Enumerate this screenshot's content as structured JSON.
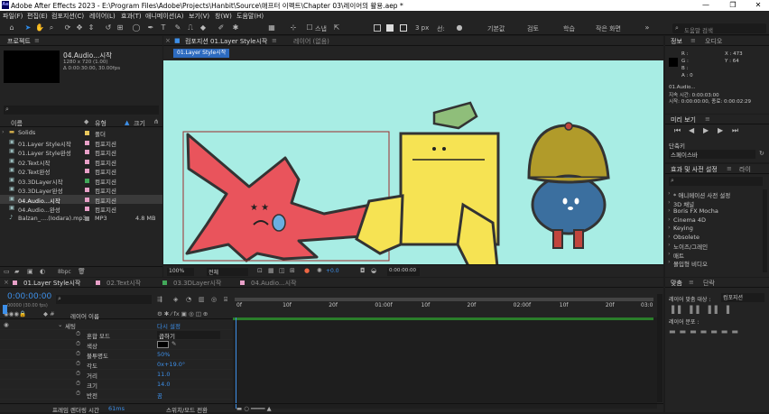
{
  "window": {
    "title": "Adobe After Effects 2023 - E:\\Program Files\\Adobe\\Projects\\Hanbit\\Source\\애프터 이펙트\\Chapter 03\\레이어의 활용.aep *",
    "minimize": "—",
    "maximize": "❐",
    "close": "✕"
  },
  "menu": [
    "파일(F)",
    "편집(E)",
    "컴포지션(C)",
    "레이어(L)",
    "효과(T)",
    "애니메이션(A)",
    "보기(V)",
    "창(W)",
    "도움말(H)"
  ],
  "toolbar": {
    "snap_label": "스냅",
    "px_value": "3 px",
    "shape_label": "칠:",
    "stroke_label": "선:",
    "workspaces": [
      "기본값",
      "검토",
      "학습",
      "작은 화면"
    ],
    "search_placeholder": "도움말 검색"
  },
  "project": {
    "tab": "프로젝트",
    "preview_name": "04.Audio...시작",
    "preview_dims": "1280 x 720 (1.00)",
    "preview_dur": "Δ 0:00:30:00, 30.00fps",
    "col_name": "이름",
    "col_type": "유형",
    "col_size": "크기",
    "items": [
      {
        "name": "Solids",
        "type": "폴더",
        "size": "",
        "color": "#e8c75c",
        "icon": "folder-icon"
      },
      {
        "name": "01.Layer Style시작",
        "type": "컴포지션",
        "size": "",
        "color": "#e8a0c8",
        "icon": "composition-icon"
      },
      {
        "name": "01.Layer Style완성",
        "type": "컴포지션",
        "size": "",
        "color": "#e8a0c8",
        "icon": "composition-icon"
      },
      {
        "name": "02.Text시작",
        "type": "컴포지션",
        "size": "",
        "color": "#e8a0c8",
        "icon": "composition-icon"
      },
      {
        "name": "02.Text완성",
        "type": "컴포지션",
        "size": "",
        "color": "#e8a0c8",
        "icon": "composition-icon"
      },
      {
        "name": "03.3DLayer시작",
        "type": "컴포지션",
        "size": "",
        "color": "#42a85a",
        "icon": "composition-icon"
      },
      {
        "name": "03.3DLayer완성",
        "type": "컴포지션",
        "size": "",
        "color": "#e8a0c8",
        "icon": "composition-icon"
      },
      {
        "name": "04.Audio...시작",
        "type": "컴포지션",
        "size": "",
        "color": "#e8a0c8",
        "icon": "composition-icon",
        "selected": true
      },
      {
        "name": "04.Audio...완성",
        "type": "컴포지션",
        "size": "",
        "color": "#e8a0c8",
        "icon": "composition-icon"
      },
      {
        "name": "Balzan_....(Iodara).mp3",
        "type": "MP3",
        "size": "4.8 MB",
        "color": "#8a8a8a",
        "icon": "audio-file-icon"
      }
    ],
    "bpc": "8bpc"
  },
  "comp": {
    "tab": "컴포지션 01.Layer Style시작",
    "layer_tab": "레이어 (없음)",
    "breadcrumb": "01.Layer Style시작",
    "zoom": "100%",
    "resolution": "전체",
    "exposure": "+0.0",
    "timecode": "0:00:00:00"
  },
  "info": {
    "tab": "정보",
    "tab2": "오디오",
    "r": "R :",
    "g": "G :",
    "b": "B :",
    "a": "A : 0",
    "x": "X : 473",
    "y": "Y : 64",
    "layer": "01.Audio...",
    "duration": "지속 시간: 0:00:03:00",
    "inout": "시작: 0:00:00:00, 종료: 0:00:02:29"
  },
  "preview": {
    "tab": "미리 보기",
    "shortcut_label": "단축키",
    "shortcut_value": "스페이스바"
  },
  "effects": {
    "tab": "효과 및 사전 설정",
    "tab2": "라이",
    "items": [
      "* 애니메이션 사전 설정",
      "3D 채널",
      "Boris FX Mocha",
      "Cinema 4D",
      "Keying",
      "Obsolete",
      "노이즈/그레인",
      "매트",
      "몰입형 비디오"
    ]
  },
  "align": {
    "tab": "맞춤",
    "tab2": "단락",
    "align_to_label": "레이어 맞춤 대상 :",
    "align_to_value": "컴포지션",
    "distribute_label": "레이어 분포 :"
  },
  "timeline": {
    "tabs": [
      "01.Layer Style시작",
      "02.Text시작",
      "03.3DLayer시작",
      "04.Audio...시작"
    ],
    "timecode": "0:00:00:00",
    "fps": "00000 (30.00 fps)",
    "layer_name_col": "레이어 이름",
    "ruler": [
      "0f",
      "10f",
      "20f",
      "01:00f",
      "10f",
      "20f",
      "02:00f",
      "10f",
      "20f",
      "03:0"
    ],
    "rows": [
      {
        "name": "세팅",
        "value": "다시 설정",
        "type": "header"
      },
      {
        "name": "혼합 모드",
        "value": "곱하기",
        "type": "dropdown"
      },
      {
        "name": "색상",
        "value": "",
        "type": "color"
      },
      {
        "name": "불투명도",
        "value": "50%"
      },
      {
        "name": "각도",
        "value": "0x+19.0°"
      },
      {
        "name": "거리",
        "value": "11.0"
      },
      {
        "name": "크기",
        "value": "14.0"
      },
      {
        "name": "반전",
        "value": "꿈"
      }
    ],
    "footer_render": "프레임 렌더링 시간",
    "footer_ms": "61ms",
    "footer_toggle": "스위치/모드 전환"
  },
  "colors": {
    "canvas_bg": "#a8ede4",
    "accent": "#2d8ceb",
    "red_char": "#e9545c",
    "yellow_char": "#f6e353",
    "green_hat": "#8fbe7a",
    "olive_hat": "#b19b2a",
    "blue_ball": "#3b6f9f"
  }
}
